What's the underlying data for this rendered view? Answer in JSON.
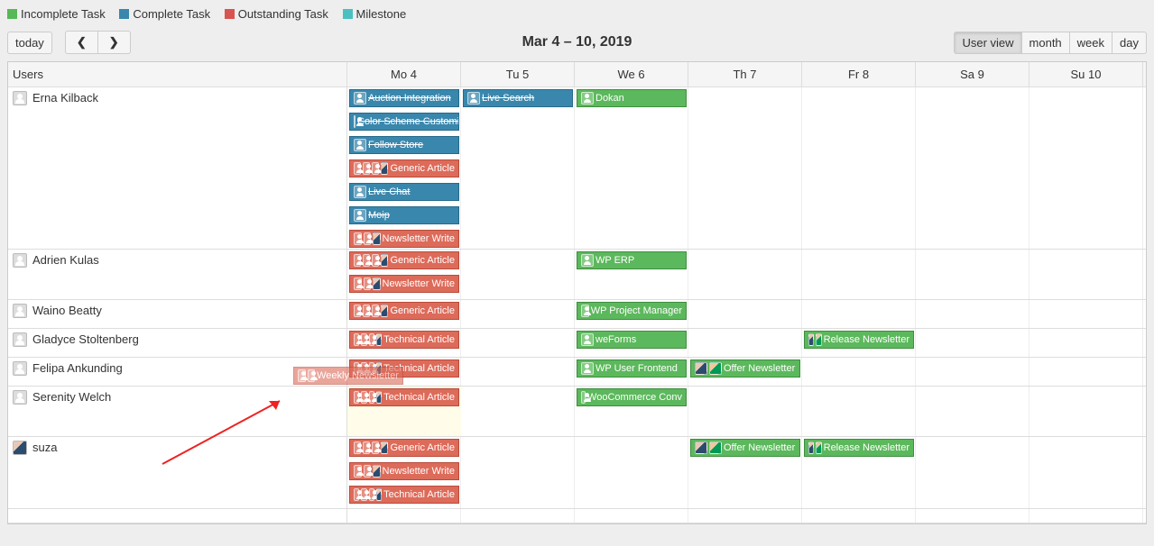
{
  "legend": {
    "incomplete": "Incomplete Task",
    "complete": "Complete Task",
    "outstanding": "Outstanding Task",
    "milestone": "Milestone"
  },
  "toolbar": {
    "today": "today",
    "date_range": "Mar 4 – 10, 2019",
    "views": {
      "user": "User view",
      "month": "month",
      "week": "week",
      "day": "day"
    }
  },
  "columns": {
    "users": "Users",
    "days": [
      "Mo 4",
      "Tu 5",
      "We 6",
      "Th 7",
      "Fr 8",
      "Sa 9",
      "Su 10"
    ]
  },
  "users": [
    {
      "name": "Erna Kilback",
      "avatar": "default"
    },
    {
      "name": "Adrien Kulas",
      "avatar": "default"
    },
    {
      "name": "Waino Beatty",
      "avatar": "default"
    },
    {
      "name": "Gladyce Stoltenberg",
      "avatar": "default"
    },
    {
      "name": "Felipa Ankunding",
      "avatar": "default"
    },
    {
      "name": "Serenity Welch",
      "avatar": "default"
    },
    {
      "name": "suza",
      "avatar": "photo"
    }
  ],
  "events": {
    "erna": [
      {
        "label": "Auction Integration",
        "type": "blue",
        "strike": true,
        "avatars": 1
      },
      {
        "label": "Color Scheme Customize",
        "type": "blue",
        "strike": true,
        "avatars": 1
      },
      {
        "label": "Follow Store",
        "type": "blue",
        "strike": true,
        "avatars": 1
      },
      {
        "label": "Generic Article",
        "type": "red",
        "avatars": 4
      },
      {
        "label": "Live Chat",
        "type": "blue",
        "strike": true,
        "avatars": 1
      },
      {
        "label": "Moip",
        "type": "blue",
        "strike": true,
        "avatars": 1
      },
      {
        "label": "Newsletter Write",
        "type": "red",
        "avatars": 3
      },
      {
        "label": "Live Search",
        "type": "blue",
        "strike": true,
        "avatars": 1
      },
      {
        "label": "Dokan",
        "type": "green",
        "avatars": 1
      }
    ],
    "adrien": [
      {
        "label": "Generic Article",
        "type": "red",
        "avatars": 4
      },
      {
        "label": "Newsletter Write",
        "type": "red",
        "avatars": 3
      },
      {
        "label": "WP ERP",
        "type": "green",
        "avatars": 1
      }
    ],
    "waino": [
      {
        "label": "Generic Article",
        "type": "red",
        "avatars": 4
      },
      {
        "label": "WP Project Manager",
        "type": "green",
        "avatars": 1
      }
    ],
    "gladyce": [
      {
        "label": "Technical Article",
        "type": "red",
        "avatars": 4
      },
      {
        "label": "weForms",
        "type": "green",
        "avatars": 1
      },
      {
        "label": "Release Newsletter",
        "type": "green",
        "avatars": 2
      }
    ],
    "felipa": [
      {
        "label": "Technical Article",
        "type": "red",
        "avatars": 4
      },
      {
        "label": "WP User Frontend",
        "type": "green",
        "avatars": 1
      },
      {
        "label": "Offer Newsletter",
        "type": "green",
        "avatars": 2
      }
    ],
    "serenity": [
      {
        "label": "Technical Article",
        "type": "red",
        "avatars": 4
      },
      {
        "label": "WooCommerce Conv",
        "type": "green",
        "avatars": 1
      }
    ],
    "suza": [
      {
        "label": "Generic Article",
        "type": "red",
        "avatars": 4
      },
      {
        "label": "Newsletter Write",
        "type": "red",
        "avatars": 3
      },
      {
        "label": "Technical Article",
        "type": "red",
        "avatars": 4
      },
      {
        "label": "Offer Newsletter",
        "type": "green",
        "avatars": 2
      },
      {
        "label": "Release Newsletter",
        "type": "green",
        "avatars": 2
      }
    ],
    "drag": {
      "label": "Weekly Newsletter"
    }
  }
}
